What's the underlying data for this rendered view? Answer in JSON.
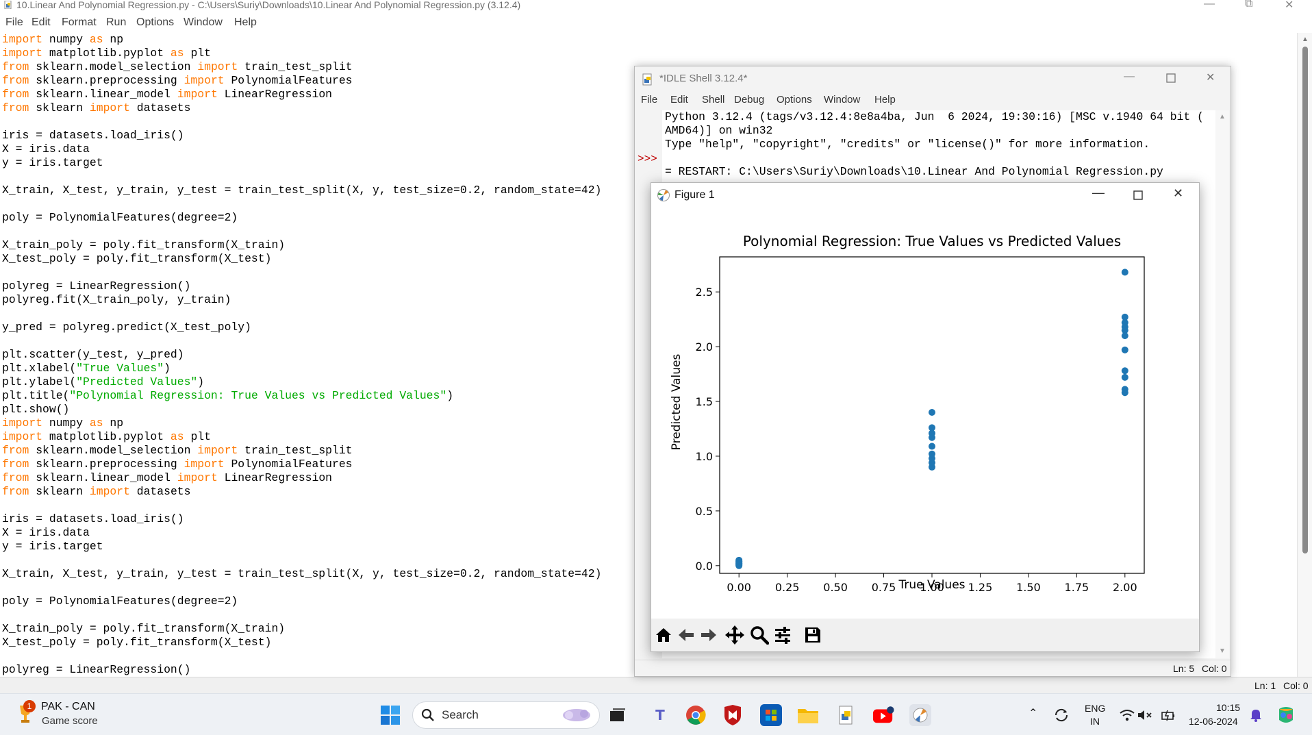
{
  "window": {
    "title": "10.Linear And Polynomial Regression.py - C:\\Users\\Suriy\\Downloads\\10.Linear And Polynomial Regression.py (3.12.4)",
    "minimize": "—",
    "maximize": "⧉",
    "close": "✕"
  },
  "menu": [
    "File",
    "Edit",
    "Format",
    "Run",
    "Options",
    "Window",
    "Help"
  ],
  "editor": {
    "lines": [
      [
        [
          "k",
          "import"
        ],
        [
          "p",
          " numpy "
        ],
        [
          "k",
          "as"
        ],
        [
          "p",
          " np"
        ]
      ],
      [
        [
          "k",
          "import"
        ],
        [
          "p",
          " matplotlib.pyplot "
        ],
        [
          "k",
          "as"
        ],
        [
          "p",
          " plt"
        ]
      ],
      [
        [
          "k",
          "from"
        ],
        [
          "p",
          " sklearn.model_selection "
        ],
        [
          "k",
          "import"
        ],
        [
          "p",
          " train_test_split"
        ]
      ],
      [
        [
          "k",
          "from"
        ],
        [
          "p",
          " sklearn.preprocessing "
        ],
        [
          "k",
          "import"
        ],
        [
          "p",
          " PolynomialFeatures"
        ]
      ],
      [
        [
          "k",
          "from"
        ],
        [
          "p",
          " sklearn.linear_model "
        ],
        [
          "k",
          "import"
        ],
        [
          "p",
          " LinearRegression"
        ]
      ],
      [
        [
          "k",
          "from"
        ],
        [
          "p",
          " sklearn "
        ],
        [
          "k",
          "import"
        ],
        [
          "p",
          " datasets"
        ]
      ],
      [],
      [
        [
          "p",
          "iris = datasets.load_iris()"
        ]
      ],
      [
        [
          "p",
          "X = iris.data"
        ]
      ],
      [
        [
          "p",
          "y = iris.target"
        ]
      ],
      [],
      [
        [
          "p",
          "X_train, X_test, y_train, y_test = train_test_split(X, y, test_size=0.2, random_state=42)"
        ]
      ],
      [],
      [
        [
          "p",
          "poly = PolynomialFeatures(degree=2)"
        ]
      ],
      [],
      [
        [
          "p",
          "X_train_poly = poly.fit_transform(X_train)"
        ]
      ],
      [
        [
          "p",
          "X_test_poly = poly.fit_transform(X_test)"
        ]
      ],
      [],
      [
        [
          "p",
          "polyreg = LinearRegression()"
        ]
      ],
      [
        [
          "p",
          "polyreg.fit(X_train_poly, y_train)"
        ]
      ],
      [],
      [
        [
          "p",
          "y_pred = polyreg.predict(X_test_poly)"
        ]
      ],
      [],
      [
        [
          "p",
          "plt.scatter(y_test, y_pred)"
        ]
      ],
      [
        [
          "p",
          "plt.xlabel("
        ],
        [
          "s",
          "\"True Values\""
        ],
        [
          "p",
          ")"
        ]
      ],
      [
        [
          "p",
          "plt.ylabel("
        ],
        [
          "s",
          "\"Predicted Values\""
        ],
        [
          "p",
          ")"
        ]
      ],
      [
        [
          "p",
          "plt.title("
        ],
        [
          "s",
          "\"Polynomial Regression: True Values vs Predicted Values\""
        ],
        [
          "p",
          ")"
        ]
      ],
      [
        [
          "p",
          "plt.show()"
        ]
      ],
      [
        [
          "k",
          "import"
        ],
        [
          "p",
          " numpy "
        ],
        [
          "k",
          "as"
        ],
        [
          "p",
          " np"
        ]
      ],
      [
        [
          "k",
          "import"
        ],
        [
          "p",
          " matplotlib.pyplot "
        ],
        [
          "k",
          "as"
        ],
        [
          "p",
          " plt"
        ]
      ],
      [
        [
          "k",
          "from"
        ],
        [
          "p",
          " sklearn.model_selection "
        ],
        [
          "k",
          "import"
        ],
        [
          "p",
          " train_test_split"
        ]
      ],
      [
        [
          "k",
          "from"
        ],
        [
          "p",
          " sklearn.preprocessing "
        ],
        [
          "k",
          "import"
        ],
        [
          "p",
          " PolynomialFeatures"
        ]
      ],
      [
        [
          "k",
          "from"
        ],
        [
          "p",
          " sklearn.linear_model "
        ],
        [
          "k",
          "import"
        ],
        [
          "p",
          " LinearRegression"
        ]
      ],
      [
        [
          "k",
          "from"
        ],
        [
          "p",
          " sklearn "
        ],
        [
          "k",
          "import"
        ],
        [
          "p",
          " datasets"
        ]
      ],
      [],
      [
        [
          "p",
          "iris = datasets.load_iris()"
        ]
      ],
      [
        [
          "p",
          "X = iris.data"
        ]
      ],
      [
        [
          "p",
          "y = iris.target"
        ]
      ],
      [],
      [
        [
          "p",
          "X_train, X_test, y_train, y_test = train_test_split(X, y, test_size=0.2, random_state=42)"
        ]
      ],
      [],
      [
        [
          "p",
          "poly = PolynomialFeatures(degree=2)"
        ]
      ],
      [],
      [
        [
          "p",
          "X_train_poly = poly.fit_transform(X_train)"
        ]
      ],
      [
        [
          "p",
          "X_test_poly = poly.fit_transform(X_test)"
        ]
      ],
      [],
      [
        [
          "p",
          "polyreg = LinearRegression()"
        ]
      ]
    ],
    "colors": {
      "keyword": "#ff7700",
      "string": "#00aa00",
      "text": "#000000"
    }
  },
  "editor_status": {
    "ln": "Ln: 1",
    "col": "Col: 0"
  },
  "shell": {
    "title": "*IDLE Shell 3.12.4*",
    "menu": [
      "File",
      "Edit",
      "Shell",
      "Debug",
      "Options",
      "Window",
      "Help"
    ],
    "prompt": ">>>",
    "lines": [
      "Python 3.12.4 (tags/v3.12.4:8e8a4ba, Jun  6 2024, 19:30:16) [MSC v.1940 64 bit (",
      "AMD64)] on win32",
      "Type \"help\", \"copyright\", \"credits\" or \"license()\" for more information.",
      "",
      "= RESTART: C:\\Users\\Suriy\\Downloads\\10.Linear And Polynomial Regression.py"
    ],
    "status": {
      "ln": "Ln: 5",
      "col": "Col: 0"
    }
  },
  "figure": {
    "title": "Figure 1",
    "toolbar": [
      "home-icon",
      "back-arrow-icon",
      "forward-arrow-icon",
      "pan-icon",
      "zoom-icon",
      "configure-subplots-icon",
      "save-icon"
    ]
  },
  "chart_data": {
    "type": "scatter",
    "title": "Polynomial Regression: True Values vs Predicted Values",
    "xlabel": "True Values",
    "ylabel": "Predicted Values",
    "xlim": [
      -0.1,
      2.1
    ],
    "ylim": [
      -0.07,
      2.82
    ],
    "xticks": [
      "0.00",
      "0.25",
      "0.50",
      "0.75",
      "1.00",
      "1.25",
      "1.50",
      "1.75",
      "2.00"
    ],
    "yticks": [
      "0.0",
      "0.5",
      "1.0",
      "1.5",
      "2.0",
      "2.5"
    ],
    "color": "#1f77b4",
    "grid": false,
    "x": [
      0,
      0,
      0,
      0,
      0,
      0,
      0,
      0,
      0,
      0,
      1,
      1,
      1,
      1,
      1,
      1,
      1,
      1,
      1,
      2,
      2,
      2,
      2,
      2,
      2,
      2,
      2,
      2,
      2,
      2
    ],
    "y": [
      0.0,
      0.01,
      0.02,
      0.03,
      0.04,
      0.05,
      0.02,
      0.03,
      0.01,
      0.04,
      0.9,
      0.94,
      0.98,
      1.02,
      1.09,
      1.17,
      1.21,
      1.26,
      1.4,
      2.68,
      2.27,
      2.22,
      2.18,
      2.15,
      2.1,
      1.97,
      1.78,
      1.72,
      1.61,
      1.58
    ]
  },
  "taskbar": {
    "widget_title": "PAK - CAN",
    "widget_sub": "Game score",
    "widget_badge": "1",
    "search_label": "Search",
    "lang_1": "ENG",
    "lang_2": "IN",
    "time": "10:15",
    "date": "12-06-2024"
  }
}
